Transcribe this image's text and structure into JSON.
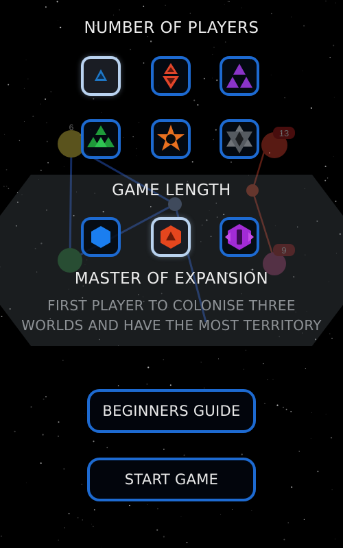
{
  "players": {
    "title": "NUMBER OF PLAYERS",
    "options": [
      {
        "count": 1,
        "icon": "one-triangle-icon",
        "color": "#1e78c8",
        "selected": true
      },
      {
        "count": 2,
        "icon": "two-triangles-icon",
        "color": "#e0452a",
        "selected": false
      },
      {
        "count": 3,
        "icon": "three-triangles-icon",
        "color": "#8a34c9",
        "selected": false
      },
      {
        "count": 4,
        "icon": "four-triangles-icon",
        "color": "#1f9a3a",
        "selected": false
      },
      {
        "count": 5,
        "icon": "five-point-star-icon",
        "color": "#e8701f",
        "selected": false
      },
      {
        "count": 6,
        "icon": "six-point-star-icon",
        "color": "#6f7378",
        "selected": false
      }
    ]
  },
  "game_length": {
    "title": "GAME LENGTH",
    "options": [
      {
        "icon": "blue-hexagon-icon",
        "color": "#1a7ef0",
        "selected": false
      },
      {
        "icon": "orange-hexagon-icon",
        "color": "#e5461e",
        "selected": true
      },
      {
        "icon": "purple-hexagon-icon",
        "color": "#a22bd6",
        "selected": false
      }
    ],
    "mode_title": "MASTER OF EXPANSION",
    "mode_description_line1": "FIRST PLAYER TO COLONISE THREE",
    "mode_description_line2": "WORLDS AND HAVE THE MOST TERRITORY"
  },
  "buttons": {
    "beginners_guide": "BEGINNERS GUIDE",
    "start_game": "START GAME"
  },
  "background_map": {
    "planet_badges": [
      "13",
      "9",
      "6"
    ]
  },
  "colors": {
    "accent_border": "#1d6ad1",
    "selected_border": "#b9d2ef",
    "text": "#ececec",
    "subtext": "#8e9296"
  }
}
